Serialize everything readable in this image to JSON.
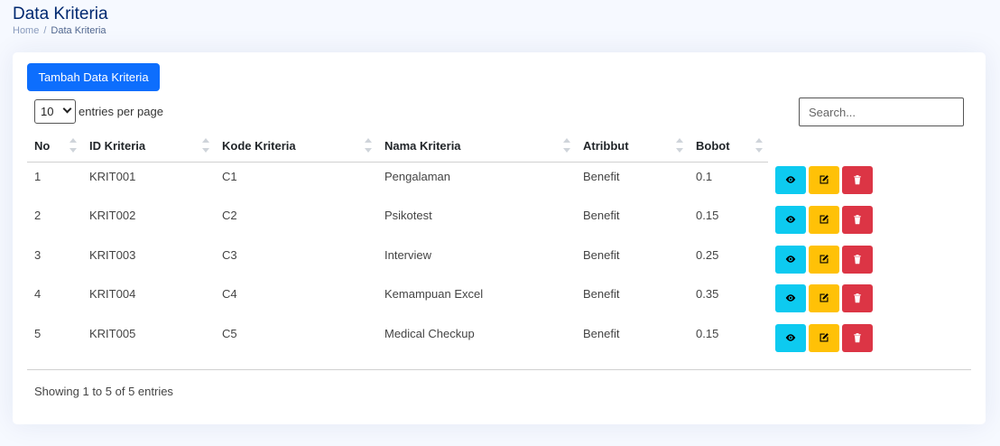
{
  "header": {
    "title": "Data Kriteria",
    "breadcrumb": {
      "home": "Home",
      "separator": "/",
      "current": "Data Kriteria"
    }
  },
  "toolbar": {
    "add_label": "Tambah Data Kriteria",
    "length_value": "10",
    "length_label": "entries per page",
    "search_placeholder": "Search..."
  },
  "table": {
    "columns": [
      "No",
      "ID Kriteria",
      "Kode Kriteria",
      "Nama Kriteria",
      "Atribbut",
      "Bobot"
    ],
    "rows": [
      [
        "1",
        "KRIT001",
        "C1",
        "Pengalaman",
        "Benefit",
        "0.1"
      ],
      [
        "2",
        "KRIT002",
        "C2",
        "Psikotest",
        "Benefit",
        "0.15"
      ],
      [
        "3",
        "KRIT003",
        "C3",
        "Interview",
        "Benefit",
        "0.25"
      ],
      [
        "4",
        "KRIT004",
        "C4",
        "Kemampuan Excel",
        "Benefit",
        "0.35"
      ],
      [
        "5",
        "KRIT005",
        "C5",
        "Medical Checkup",
        "Benefit",
        "0.15"
      ]
    ]
  },
  "footer": {
    "info": "Showing 1 to 5 of 5 entries"
  },
  "colors": {
    "primary": "#0d6efd",
    "info": "#0dcaf0",
    "warning": "#ffc107",
    "danger": "#dc3545",
    "title": "#012970"
  },
  "icons": {
    "view": "eye-icon",
    "edit": "edit-icon",
    "delete": "trash-icon"
  }
}
